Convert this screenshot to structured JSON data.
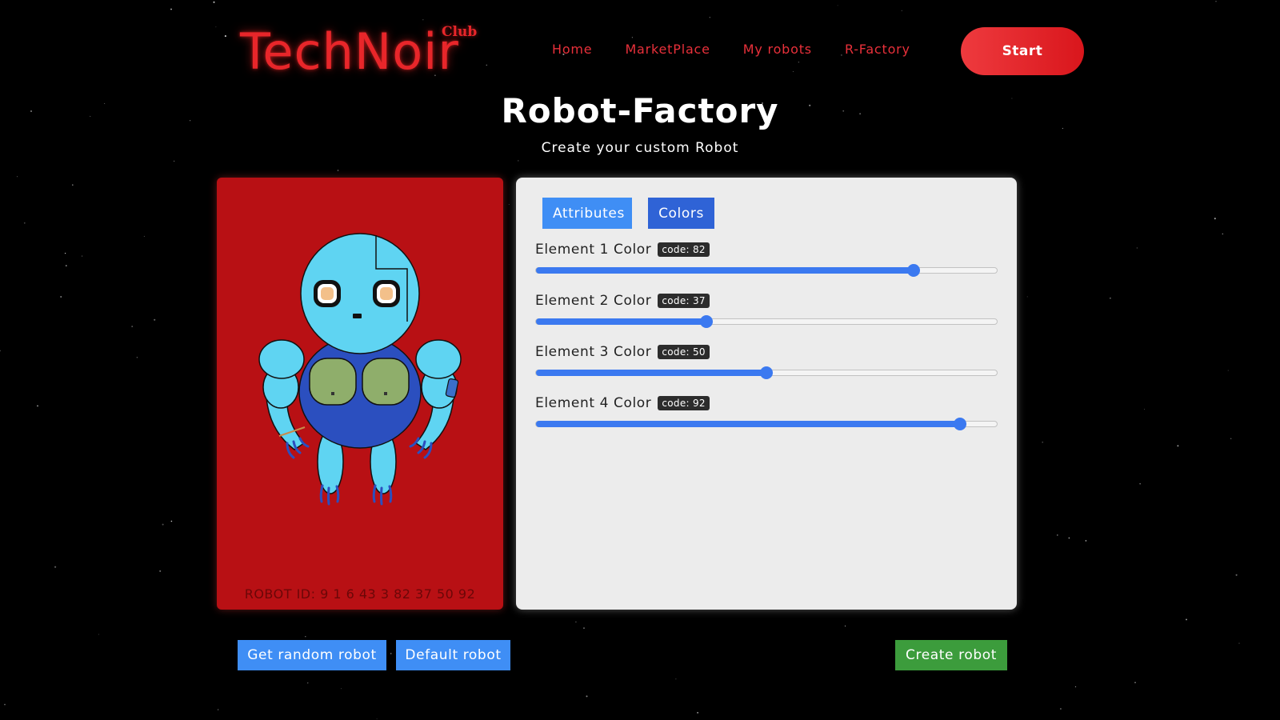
{
  "header": {
    "logo_text": "TechNoir",
    "logo_super": "Club",
    "nav": [
      "Home",
      "MarketPlace",
      "My robots",
      "R-Factory"
    ],
    "start_label": "Start"
  },
  "main": {
    "title": "Robot-Factory",
    "subtitle": "Create your custom Robot"
  },
  "robot_card": {
    "id_text": "ROBOT ID: 9 1 6 43 3 82 37 50 92",
    "background_color": "#b81014",
    "robot_colors": {
      "body_light": "#5fd4f2",
      "torso": "#2b4fbf",
      "chest_plates": "#8fae6b",
      "eyes": "#f3c08a"
    }
  },
  "panel": {
    "tabs": [
      {
        "label": "Attributes"
      },
      {
        "label": "Colors"
      }
    ],
    "active_tab": "Colors",
    "sliders": [
      {
        "label": "Element 1 Color",
        "code_text": "code: 82",
        "value": 82,
        "max": 100
      },
      {
        "label": "Element 2 Color",
        "code_text": "code: 37",
        "value": 37,
        "max": 100
      },
      {
        "label": "Element 3 Color",
        "code_text": "code: 50",
        "value": 50,
        "max": 100
      },
      {
        "label": "Element 4 Color",
        "code_text": "code: 92",
        "value": 92,
        "max": 100
      }
    ]
  },
  "actions": {
    "random_label": "Get random robot",
    "default_label": "Default robot",
    "create_label": "Create robot"
  },
  "colors": {
    "accent_red": "#e8262a",
    "button_blue": "#3f8ef5",
    "tab_active_blue": "#2f63d6",
    "create_green": "#3c9c3c",
    "slider_blue": "#3b79f0"
  }
}
